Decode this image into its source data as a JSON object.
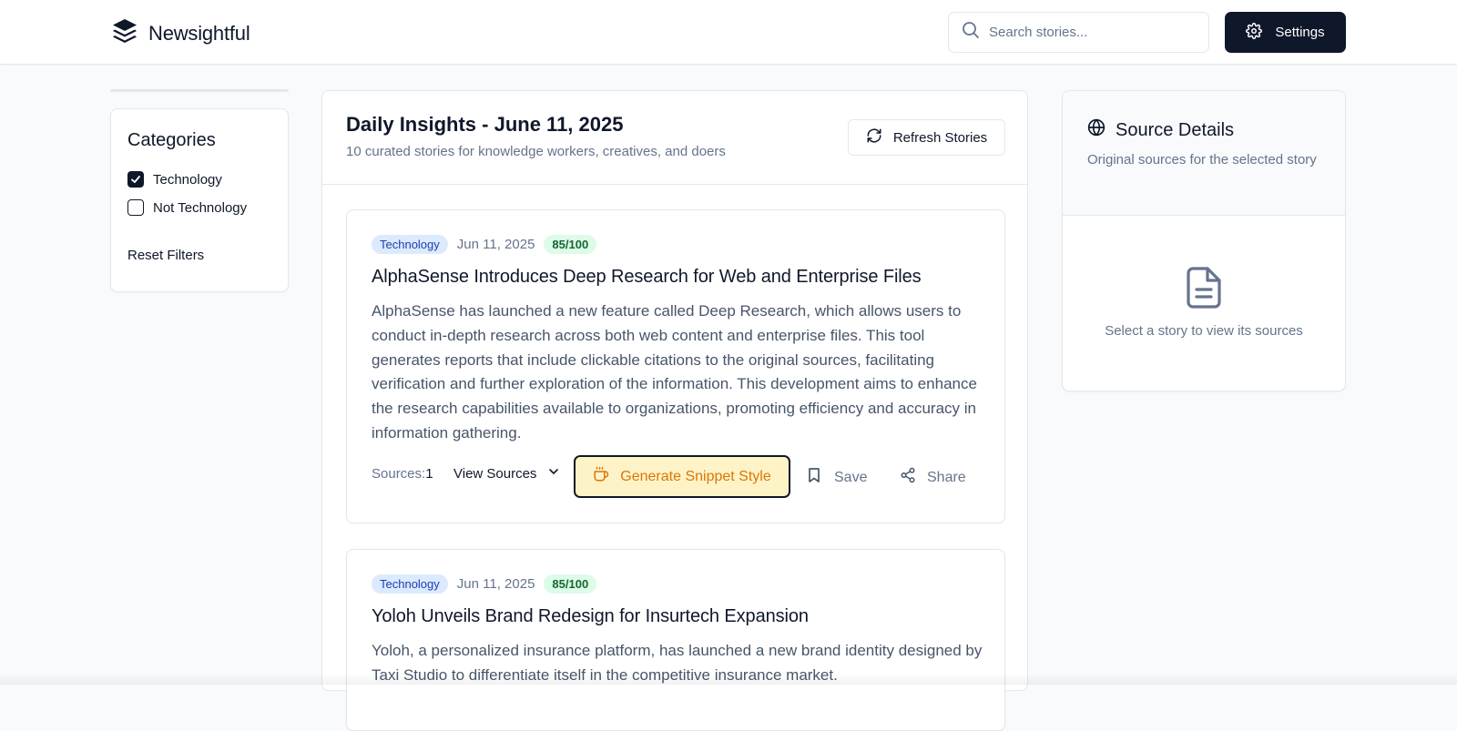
{
  "app": {
    "name": "Newsightful"
  },
  "header": {
    "search_placeholder": "Search stories...",
    "settings_label": "Settings"
  },
  "sidebar": {
    "title": "Categories",
    "categories": [
      {
        "label": "Technology",
        "checked": true
      },
      {
        "label": "Not Technology",
        "checked": false
      }
    ],
    "reset_label": "Reset Filters"
  },
  "feed": {
    "title": "Daily Insights - June 11, 2025",
    "subtitle": "10 curated stories for knowledge workers, creatives, and doers",
    "refresh_label": "Refresh Stories",
    "stories": [
      {
        "category": "Technology",
        "date": "Jun 11, 2025",
        "score": "85/100",
        "title": "AlphaSense Introduces Deep Research for Web and Enterprise Files",
        "summary": "AlphaSense has launched a new feature called Deep Research, which allows users to conduct in-depth research across both web content and enterprise files. This tool generates reports that include clickable citations to the original sources, facilitating verification and further exploration of the information. This development aims to enhance the research capabilities available to organizations, promoting efficiency and accuracy in information gathering.",
        "sources_label": "Sources:",
        "sources_count": "1",
        "view_sources_label": "View Sources",
        "generate_label": "Generate Snippet Style",
        "save_label": "Save",
        "share_label": "Share"
      },
      {
        "category": "Technology",
        "date": "Jun 11, 2025",
        "score": "85/100",
        "title": "Yoloh Unveils Brand Redesign for Insurtech Expansion",
        "summary": "Yoloh, a personalized insurance platform, has launched a new brand identity designed by Taxi Studio to differentiate itself in the competitive insurance market."
      }
    ]
  },
  "source_details": {
    "title": "Source Details",
    "subtitle": "Original sources for the selected story",
    "empty_text": "Select a story to view its sources"
  },
  "colors": {
    "primary": "#0f172a",
    "category_badge_bg": "#dbeafe",
    "score_badge_bg": "#dcfce7",
    "snippet_button_bg": "#fef3c7",
    "snippet_button_text": "#d97706"
  }
}
